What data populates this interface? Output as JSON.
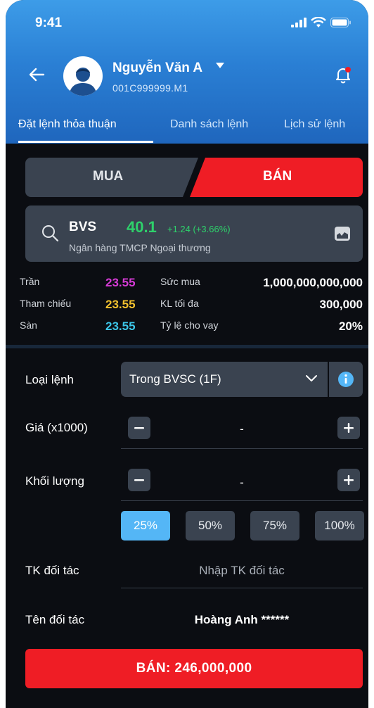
{
  "status_bar": {
    "time": "9:41"
  },
  "header": {
    "user_name": "Nguyễn Văn A",
    "account_id": "001C999999.M1"
  },
  "tabs": [
    {
      "label": "Đặt lệnh thỏa thuận",
      "active": true
    },
    {
      "label": "Danh sách lệnh",
      "active": false
    },
    {
      "label": "Lịch sử lệnh",
      "active": false
    }
  ],
  "side_toggle": {
    "buy_label": "MUA",
    "sell_label": "BÁN",
    "selected": "sell"
  },
  "stock": {
    "ticker": "BVS",
    "price": "40.1",
    "change": "+1.24 (+3.66%)",
    "company": "Ngân hàng TMCP Ngoại thương"
  },
  "ref_prices": {
    "ceiling_label": "Trần",
    "ceiling_value": "23.55",
    "reference_label": "Tham chiếu",
    "reference_value": "23.55",
    "floor_label": "Sàn",
    "floor_value": "23.55"
  },
  "account_info": {
    "buying_power_label": "Sức mua",
    "buying_power_value": "1,000,000,000,000",
    "max_volume_label": "KL tối đa",
    "max_volume_value": "300,000",
    "loan_ratio_label": "Tỷ lệ cho vay",
    "loan_ratio_value": "20%"
  },
  "form": {
    "order_type_label": "Loại lệnh",
    "order_type_value": "Trong BVSC (1F)",
    "price_label": "Giá (x1000)",
    "price_value": "-",
    "volume_label": "Khối lượng",
    "volume_value": "-",
    "percent_options": [
      "25%",
      "50%",
      "75%",
      "100%"
    ],
    "percent_selected": "25%",
    "partner_account_label": "TK đối tác",
    "partner_account_placeholder": "Nhập TK đối tác",
    "partner_name_label": "Tên đối tác",
    "partner_name_value": "Hoàng Anh ******"
  },
  "submit": {
    "label": "BÁN: 246,000,000"
  },
  "colors": {
    "sell": "#ef1d25",
    "buy_inactive": "#3a4350",
    "up": "#2ed16b",
    "ceiling": "#d63bd6",
    "reference": "#f2c12e",
    "floor": "#3cc6e8",
    "accent": "#54b6f6"
  }
}
